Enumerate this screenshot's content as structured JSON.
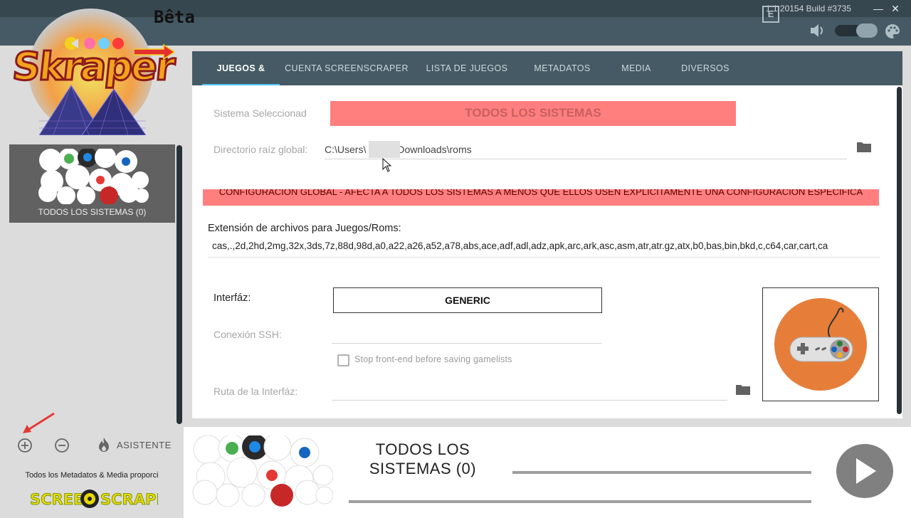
{
  "window": {
    "build": "1.1.20154 Build #3735",
    "minimize_glyph": "—",
    "close_glyph": "✕"
  },
  "logo": {
    "beta_label": "Bêta",
    "app_name": "Skraper"
  },
  "toolbar": {
    "e_label": "E",
    "icons": [
      "e-icon",
      "volume-icon",
      "toggle-switch",
      "palette-icon"
    ]
  },
  "sidebar": {
    "selected_system": "TODOS LOS SISTEMAS (0)",
    "wizard_label": "ASISTENTE",
    "credit": "Todos los Metadatos & Media proporci",
    "provider_logo": "SCREENSCRAPER"
  },
  "tabs": [
    {
      "label": "JUEGOS &",
      "active": true
    },
    {
      "label": "CUENTA SCREENSCRAPER",
      "active": false
    },
    {
      "label": "LISTA DE JUEGOS",
      "active": false
    },
    {
      "label": "METADATOS",
      "active": false
    },
    {
      "label": "MEDIA",
      "active": false
    },
    {
      "label": "DIVERSOS",
      "active": false
    }
  ],
  "form": {
    "system_label": "Sistema Seleccionad",
    "system_value": "TODOS LOS SISTEMAS",
    "root_dir_label": "Directorio raíz global:",
    "root_dir_prefix": "C:\\Users\\",
    "root_dir_suffix": "Downloads\\roms",
    "warning": "CONFIGURACIÓN GLOBAL - AFECTA A TODOS LOS SISTEMAS A MENOS QUE ELLOS USEN EXPLÍCITAMENTE UNA CONFIGURACIÓN ESPECÍFICA",
    "ext_label": "Extensión de archivos para Juegos/Roms:",
    "ext_value": "cas,.,2d,2hd,2mg,32x,3ds,7z,88d,98d,a0,a22,a26,a52,a78,abs,ace,adf,adl,adz,apk,arc,ark,asc,asm,atr,atr.gz,atx,b0,bas,bin,bkd,c,c64,car,cart,ca",
    "frontend_label": "Interfáz:",
    "frontend_value": "GENERIC",
    "ssh_label": "Conexión SSH:",
    "stop_frontend_label": "Stop front-end before saving gamelists",
    "stop_frontend_checked": false,
    "frontend_path_label": "Ruta de la Interfáz:"
  },
  "bottom": {
    "system_name": "TODOS LOS SISTEMAS (0)"
  },
  "colors": {
    "header_bg": "#455a64",
    "accent": "#4fc3f7",
    "banner_red": "#ff7f7f",
    "controller_orange": "#e67e3a"
  }
}
